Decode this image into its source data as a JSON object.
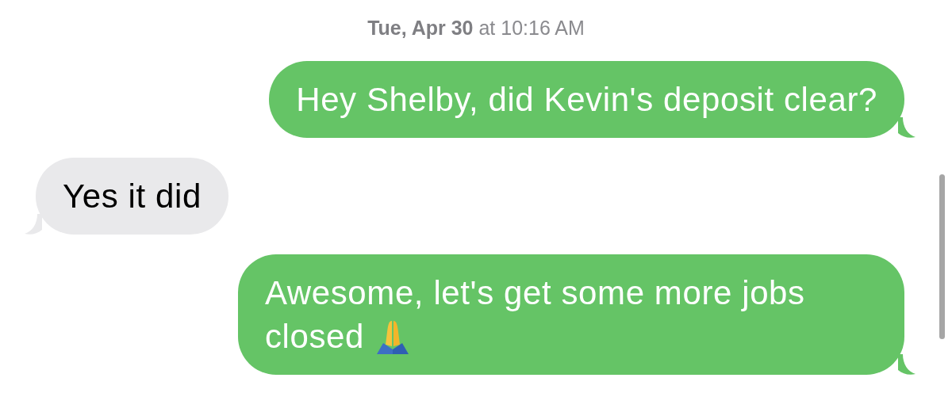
{
  "timestamp": "**Tue, Apr 30** at 10:16 AM",
  "messages": [
    {
      "kind": "sent",
      "text": "Hey Shelby, did Kevin's deposit clear?"
    },
    {
      "kind": "received",
      "text": "Yes it did"
    },
    {
      "kind": "sent_emoji",
      "text": "Awesome, let's get some more jobs closed"
    }
  ]
}
